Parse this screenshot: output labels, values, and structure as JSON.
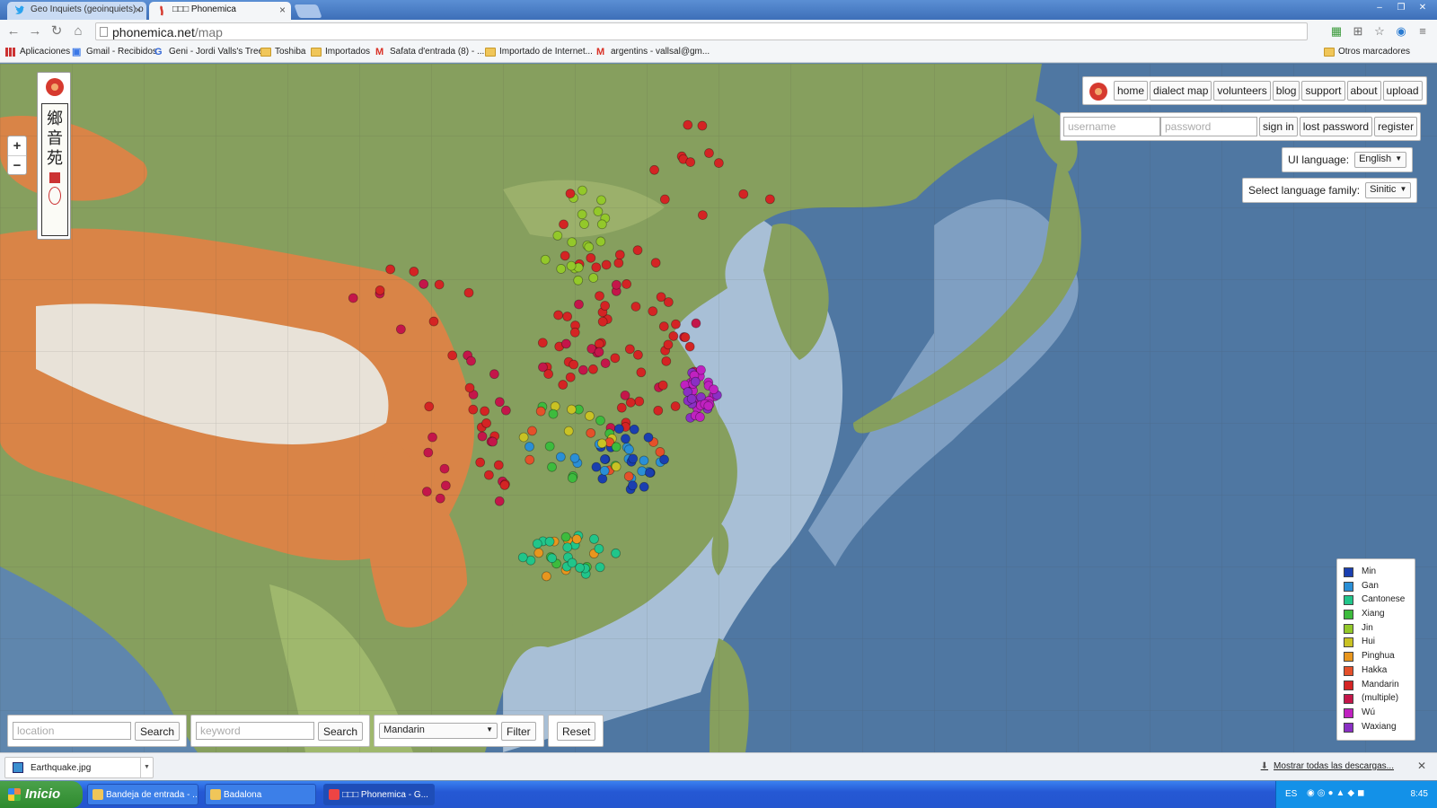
{
  "browser": {
    "tabs": [
      {
        "title": "Geo Inquiets (geoinquiets) o",
        "active": false
      },
      {
        "title": "□□□ Phonemica",
        "active": true
      }
    ],
    "url_host": "phonemica.net",
    "url_path": "/map",
    "bookmarks": [
      {
        "label": "Aplicaciones",
        "icon": "apps-icon"
      },
      {
        "label": "Gmail - Recibidos",
        "icon": "gmail-icon"
      },
      {
        "label": "Geni - Jordi Valls's Tree",
        "icon": "geni-icon"
      },
      {
        "label": "Toshiba",
        "icon": "folder-icon"
      },
      {
        "label": "Importados",
        "icon": "folder-icon"
      },
      {
        "label": "Safata d'entrada (8) - ...",
        "icon": "gmail-icon"
      },
      {
        "label": "Importado de Internet...",
        "icon": "folder-icon"
      },
      {
        "label": "argentins - vallsal@gm...",
        "icon": "gmail-icon"
      }
    ],
    "other_bookmarks": "Otros marcadores"
  },
  "site": {
    "logo_chars": [
      "鄉",
      "音",
      "苑"
    ],
    "nav": [
      "home",
      "dialect map",
      "volunteers",
      "blog",
      "support",
      "about",
      "upload"
    ],
    "login": {
      "username_placeholder": "username",
      "password_placeholder": "password",
      "sign_in": "sign in",
      "lost_password": "lost password",
      "register": "register"
    },
    "ui_language_label": "UI language:",
    "ui_language_value": "English",
    "family_label": "Select language family:",
    "family_value": "Sinitic",
    "zoom_in": "+",
    "zoom_out": "−"
  },
  "bottom": {
    "location_placeholder": "location",
    "search_label": "Search",
    "keyword_placeholder": "keyword",
    "search2_label": "Search",
    "dialect_value": "Mandarin",
    "filter_label": "Filter",
    "reset_label": "Reset"
  },
  "legend": [
    {
      "label": "Min",
      "color": "#1a3fb0"
    },
    {
      "label": "Gan",
      "color": "#2a8fd6"
    },
    {
      "label": "Cantonese",
      "color": "#21c58a"
    },
    {
      "label": "Xiang",
      "color": "#3dbb3d"
    },
    {
      "label": "Jin",
      "color": "#93c82a"
    },
    {
      "label": "Hui",
      "color": "#c9c224"
    },
    {
      "label": "Pinghua",
      "color": "#e8961e"
    },
    {
      "label": "Hakka",
      "color": "#e5502a"
    },
    {
      "label": "Mandarin",
      "color": "#d42424"
    },
    {
      "label": "(multiple)",
      "color": "#c4164a"
    },
    {
      "label": "Wú",
      "color": "#c021c0"
    },
    {
      "label": "Waxiang",
      "color": "#8a2fc4"
    }
  ],
  "downloads": {
    "file": "Earthquake.jpg",
    "show_all": "Mostrar todas las descargas..."
  },
  "taskbar": {
    "start": "Inicio",
    "tasks": [
      "Bandeja de entrada - ...",
      "Badalona",
      "□□□ Phonemica - G..."
    ],
    "lang": "ES",
    "clock": "8:45"
  }
}
